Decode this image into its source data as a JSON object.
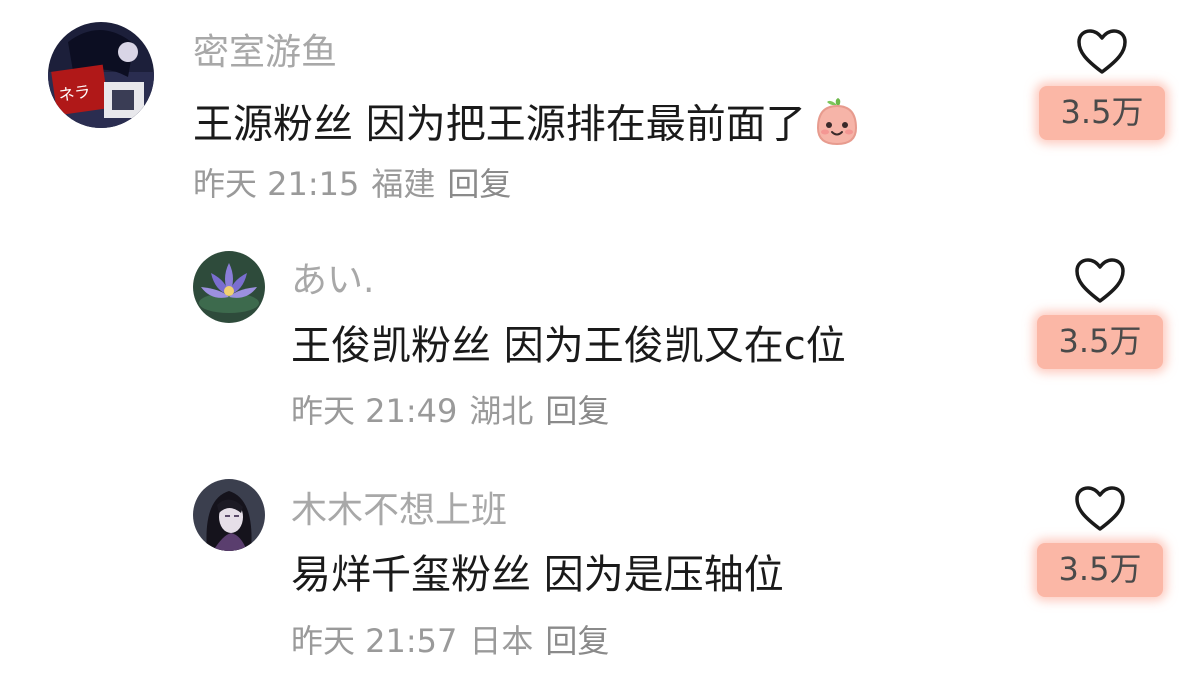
{
  "colors": {
    "username": "#a8a8a8",
    "content": "#1a1a1a",
    "meta": "#9a9a9a",
    "like_highlight": "#fbb7a6"
  },
  "comments": [
    {
      "username": "密室游鱼",
      "text": "王源粉丝 因为把王源排在最前面了",
      "emoji": "smiling-blob-emoji",
      "time": "昨天 21:15",
      "location": "福建",
      "reply": "回复",
      "likes": "3.5万",
      "avatar": "anime-book-avatar"
    },
    {
      "username": "あい.",
      "text": "王俊凯粉丝 因为王俊凯又在c位",
      "time": "昨天 21:49",
      "location": "湖北",
      "reply": "回复",
      "likes": "3.5万",
      "avatar": "lotus-avatar"
    },
    {
      "username": "木木不想上班",
      "text": "易烊千玺粉丝 因为是压轴位",
      "time": "昨天 21:57",
      "location": "日本",
      "reply": "回复",
      "likes": "3.5万",
      "avatar": "anime-girl-avatar"
    }
  ]
}
